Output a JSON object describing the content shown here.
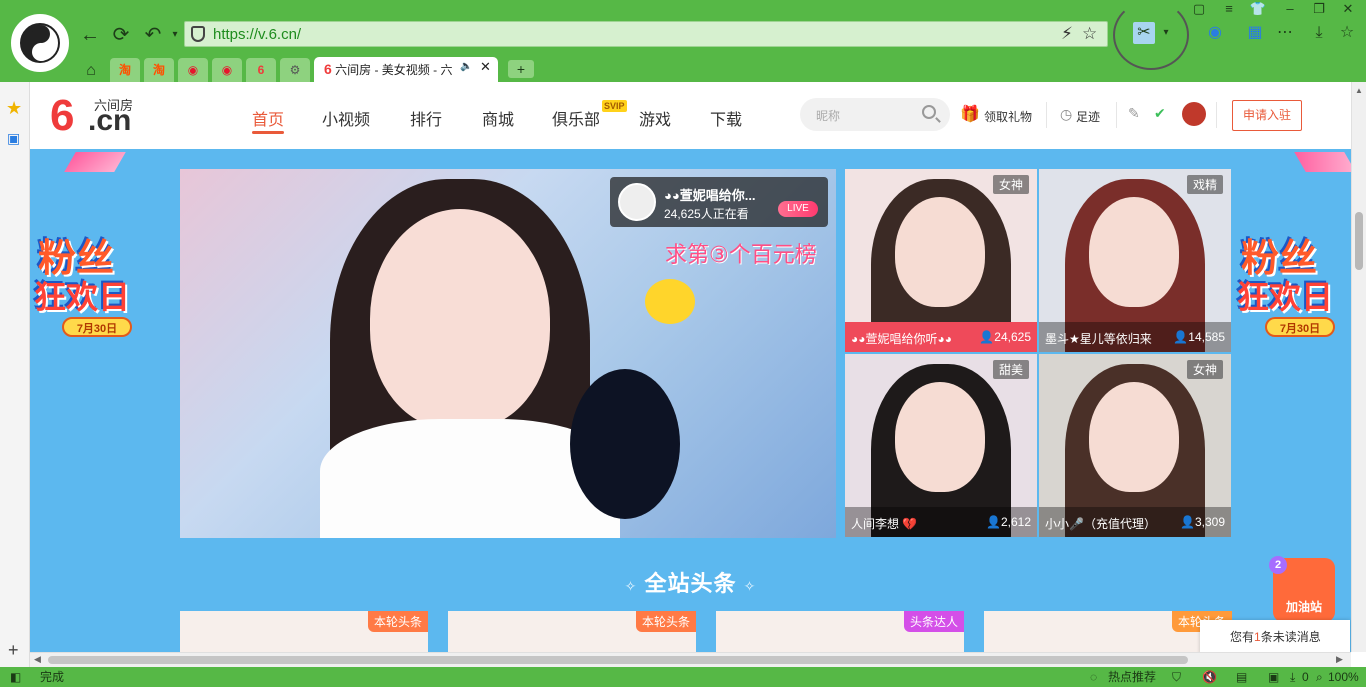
{
  "browser": {
    "address": {
      "url_host": "https://v.6.cn/",
      "url_path": ""
    },
    "tabs": [
      {
        "label": "淘",
        "color": "#ff5000"
      },
      {
        "label": "淘",
        "color": "#ff5000"
      },
      {
        "label": "◉",
        "color": "#e6162d"
      },
      {
        "label": "◉",
        "color": "#e6162d"
      },
      {
        "label": "6",
        "color": "#ef3b3b"
      },
      {
        "label": "⚙",
        "color": "#555555"
      }
    ],
    "active_tab": {
      "title": "六间房 - 美女视频 - 六",
      "icon": "6"
    },
    "status": {
      "left": "完成",
      "hot": "热点推荐",
      "counter": "0",
      "zoom": "100%"
    }
  },
  "site": {
    "logo_text": "六间房",
    "logo_six": "6",
    "logo_cn": ".cn",
    "nav": [
      "首页",
      "小视频",
      "排行",
      "商城",
      "俱乐部",
      "游戏",
      "下载"
    ],
    "svip": "SVIP",
    "search_placeholder": "昵称",
    "gift": "领取礼物",
    "footprint": "足迹",
    "join": "申请入驻"
  },
  "banner": {
    "line1": "粉丝",
    "line2": "狂欢日",
    "date": "7月30日"
  },
  "player": {
    "streamer": "◕◕萱妮唱给你...",
    "viewers": "24,625人正在看",
    "badge": "LIVE",
    "promo": "求第③个百元榜"
  },
  "grid": [
    {
      "tag": "女神",
      "name": "◕◕萱妮唱给你听◕◕",
      "count": "24,625",
      "bar": "#ef4a5a",
      "bg": "#f2e3e3"
    },
    {
      "tag": "戏精",
      "name": "墨斗★星儿等依归来",
      "count": "14,585",
      "bar": "rgba(0,0,0,0.35)",
      "bg": "#dfe2ea"
    },
    {
      "tag": "甜美",
      "name": "人间李想 💔",
      "count": "2,612",
      "bar": "rgba(0,0,0,0.35)",
      "bg": "#e8dfe6"
    },
    {
      "tag": "女神",
      "name": "小小🎤（充值代理）",
      "count": "3,309",
      "bar": "rgba(0,0,0,0.35)",
      "bg": "#d8d5d0"
    }
  ],
  "section": {
    "title": "全站头条"
  },
  "cards": [
    {
      "tag": "本轮头条",
      "color": "#ff7a45"
    },
    {
      "tag": "本轮头条",
      "color": "#ff7a45"
    },
    {
      "tag": "头条达人",
      "color": "#d44fe8"
    },
    {
      "tag": "本轮头条",
      "color": "#ff9a3a"
    }
  ],
  "message": {
    "pre": "您有",
    "num": "1",
    "post": "条未读消息"
  },
  "oil": {
    "label": "加油站",
    "count": "2"
  }
}
